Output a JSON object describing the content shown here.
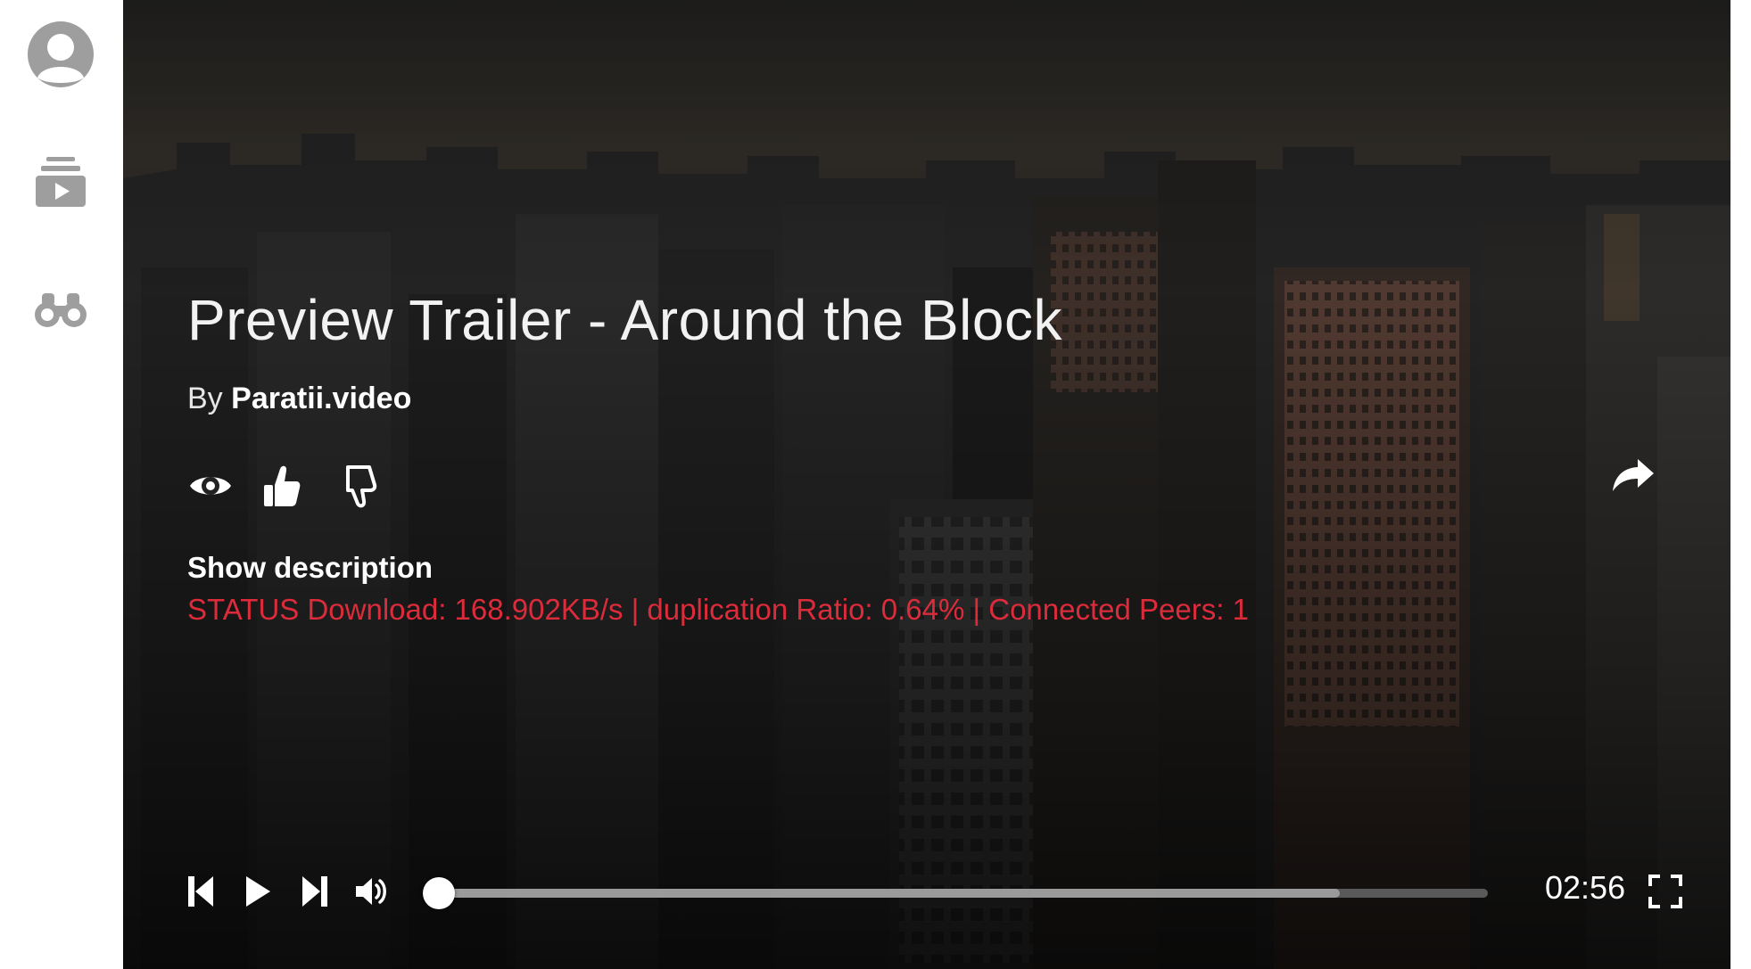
{
  "sidebar": {
    "items": [
      {
        "icon": "user-avatar-icon"
      },
      {
        "icon": "video-library-icon"
      },
      {
        "icon": "binoculars-icon"
      }
    ]
  },
  "video": {
    "title": "Preview Trailer - Around the Block",
    "by_prefix": "By",
    "author": "Paratii.video",
    "show_description_label": "Show description",
    "status": "STATUS Download: 168.902KB/s | duplication Ratio: 0.64% | Connected Peers: 1"
  },
  "controls": {
    "time": "02:56",
    "progress_fraction": 0.01,
    "buffered_fraction": 0.86
  },
  "colors": {
    "status": "#dc2b3a",
    "background": "#141414",
    "sidebar": "#ffffff"
  }
}
